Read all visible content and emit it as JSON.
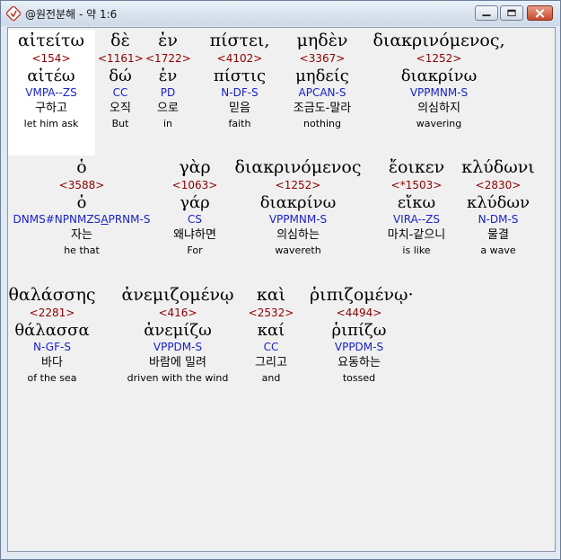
{
  "window": {
    "title": "@원전분해 - 약 1:6"
  },
  "rows": [
    [
      {
        "greek": "αἰτείτω",
        "strong": "<154>",
        "lemma": "αἰτέω",
        "morph": "VMPA--ZS",
        "ko": "구하고",
        "en": "let him ask"
      },
      {
        "greek": "δὲ",
        "strong": "<1161>",
        "lemma": "δώ",
        "morph": "CC",
        "ko": "오직",
        "en": "But"
      },
      {
        "greek": "ἐν",
        "strong": "<1722>",
        "lemma": "ἐν",
        "morph": "PD",
        "ko": "으로",
        "en": "in"
      },
      {
        "greek": "πίστει,",
        "strong": "<4102>",
        "lemma": "πίστις",
        "morph": "N-DF-S",
        "ko": "믿음",
        "en": "faith"
      },
      {
        "greek": "μηδὲν",
        "strong": "<3367>",
        "lemma": "μηδείς",
        "morph": "APCAN-S",
        "ko": "조금도-말라",
        "en": "nothing"
      },
      {
        "greek": "διακρινόμενος,",
        "strong": "<1252>",
        "lemma": "διακρίνω",
        "morph": "VPPMNM-S",
        "ko": "의심하지",
        "en": "wavering"
      }
    ],
    [
      {
        "greek": "ὁ",
        "strong": "<3588>",
        "lemma": "ὁ",
        "morph": "DNMS#NPNMZS",
        "morph_u": "A",
        "morph_end": "PRNM-S",
        "ko": "자는",
        "en": "he that"
      },
      {
        "greek": "γὰρ",
        "strong": "<1063>",
        "lemma": "γάρ",
        "morph": "CS",
        "ko": "왜냐하면",
        "en": "For"
      },
      {
        "greek": "διακρινόμενος",
        "strong": "<1252>",
        "lemma": "διακρίνω",
        "morph": "VPPMNM-S",
        "ko": "의심하는",
        "en": "wavereth"
      },
      {
        "greek": "ἔοικεν",
        "strong": "<*1503>",
        "lemma": "εἴκω",
        "morph": "VIRA--ZS",
        "ko": "마치-같으니",
        "en": "is like"
      },
      {
        "greek": "κλύδωνι",
        "strong": "<2830>",
        "lemma": "κλύδων",
        "morph": "N-DM-S",
        "ko": "물결",
        "en": "a wave"
      }
    ],
    [
      {
        "greek": "θαλάσσης",
        "strong": "<2281>",
        "lemma": "θάλασσα",
        "morph": "N-GF-S",
        "ko": "바다",
        "en": "of the sea"
      },
      {
        "greek": "ἀνεμιζομένῳ",
        "strong": "<416>",
        "lemma": "ἀνεμίζω",
        "morph": "VPPDM-S",
        "ko": "바람에 밀려",
        "en": "driven with the wind"
      },
      {
        "greek": "καὶ",
        "strong": "<2532>",
        "lemma": "καί",
        "morph": "CC",
        "ko": "그리고",
        "en": "and"
      },
      {
        "greek": "ῥιπιζομένῳ·",
        "strong": "<4494>",
        "lemma": "ῥιπίζω",
        "morph": "VPPDM-S",
        "ko": "요동하는",
        "en": "tossed"
      }
    ]
  ]
}
